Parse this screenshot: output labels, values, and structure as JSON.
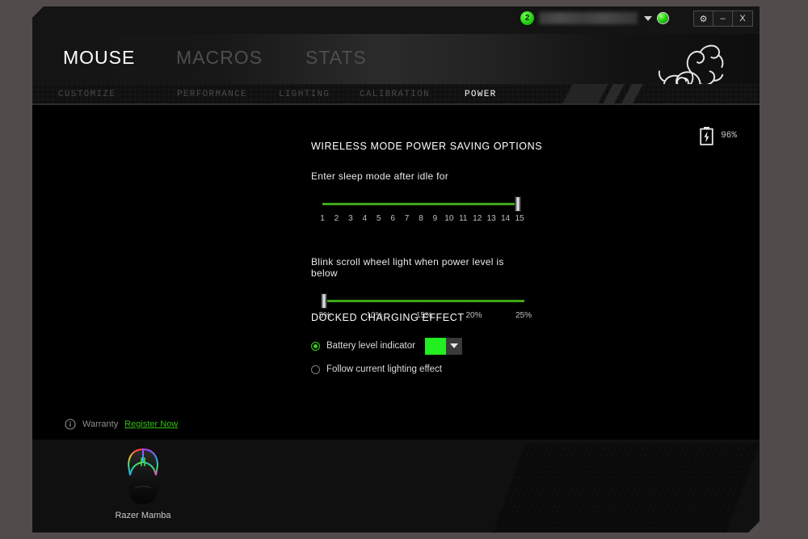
{
  "titlebar": {
    "notification_count": "2",
    "account_name_redacted": "",
    "caret_icon": "chevron-down-icon",
    "globe_icon": "globe-icon",
    "controls": [
      {
        "name": "settings",
        "label": "⚙",
        "icon": "gear-icon"
      },
      {
        "name": "minimize",
        "label": "–",
        "icon": "minimize-icon"
      },
      {
        "name": "close",
        "label": "X",
        "icon": "close-icon"
      }
    ]
  },
  "main_tabs": [
    {
      "label": "MOUSE",
      "active": true
    },
    {
      "label": "MACROS",
      "active": false
    },
    {
      "label": "STATS",
      "active": false
    }
  ],
  "sub_tabs": [
    {
      "label": "CUSTOMIZE",
      "active": false
    },
    {
      "label": "PERFORMANCE",
      "active": false
    },
    {
      "label": "LIGHTING",
      "active": false
    },
    {
      "label": "CALIBRATION",
      "active": false
    },
    {
      "label": "POWER",
      "active": true
    }
  ],
  "battery": {
    "percent": "96%",
    "icon": "battery-charging-icon"
  },
  "content": {
    "wireless_heading": "WIRELESS MODE POWER SAVING OPTIONS",
    "sleep": {
      "label": "Enter sleep mode after idle for",
      "value": 15,
      "min": 1,
      "max": 15,
      "ticks": [
        "1",
        "2",
        "3",
        "4",
        "5",
        "6",
        "7",
        "8",
        "9",
        "10",
        "11",
        "12",
        "13",
        "14",
        "15"
      ]
    },
    "blink": {
      "label": "Blink scroll wheel light when power level is below",
      "value": "5%",
      "ticks": [
        "5%",
        "10%",
        "15%",
        "20%",
        "25%"
      ]
    },
    "docked_heading": "DOCKED CHARGING EFFECT",
    "options": [
      {
        "label": "Battery level indicator",
        "selected": true,
        "color": "#22ee22"
      },
      {
        "label": "Follow current lighting effect",
        "selected": false
      }
    ],
    "warranty": {
      "icon": "info-icon",
      "label": "Warranty",
      "link": "Register Now"
    }
  },
  "device_bar": {
    "device_name": "Razer Mamba",
    "device_icon": "mouse-icon"
  },
  "colors": {
    "accent_green": "#33c016",
    "slider_green": "#3fa716",
    "swatch_green": "#22ee22"
  }
}
